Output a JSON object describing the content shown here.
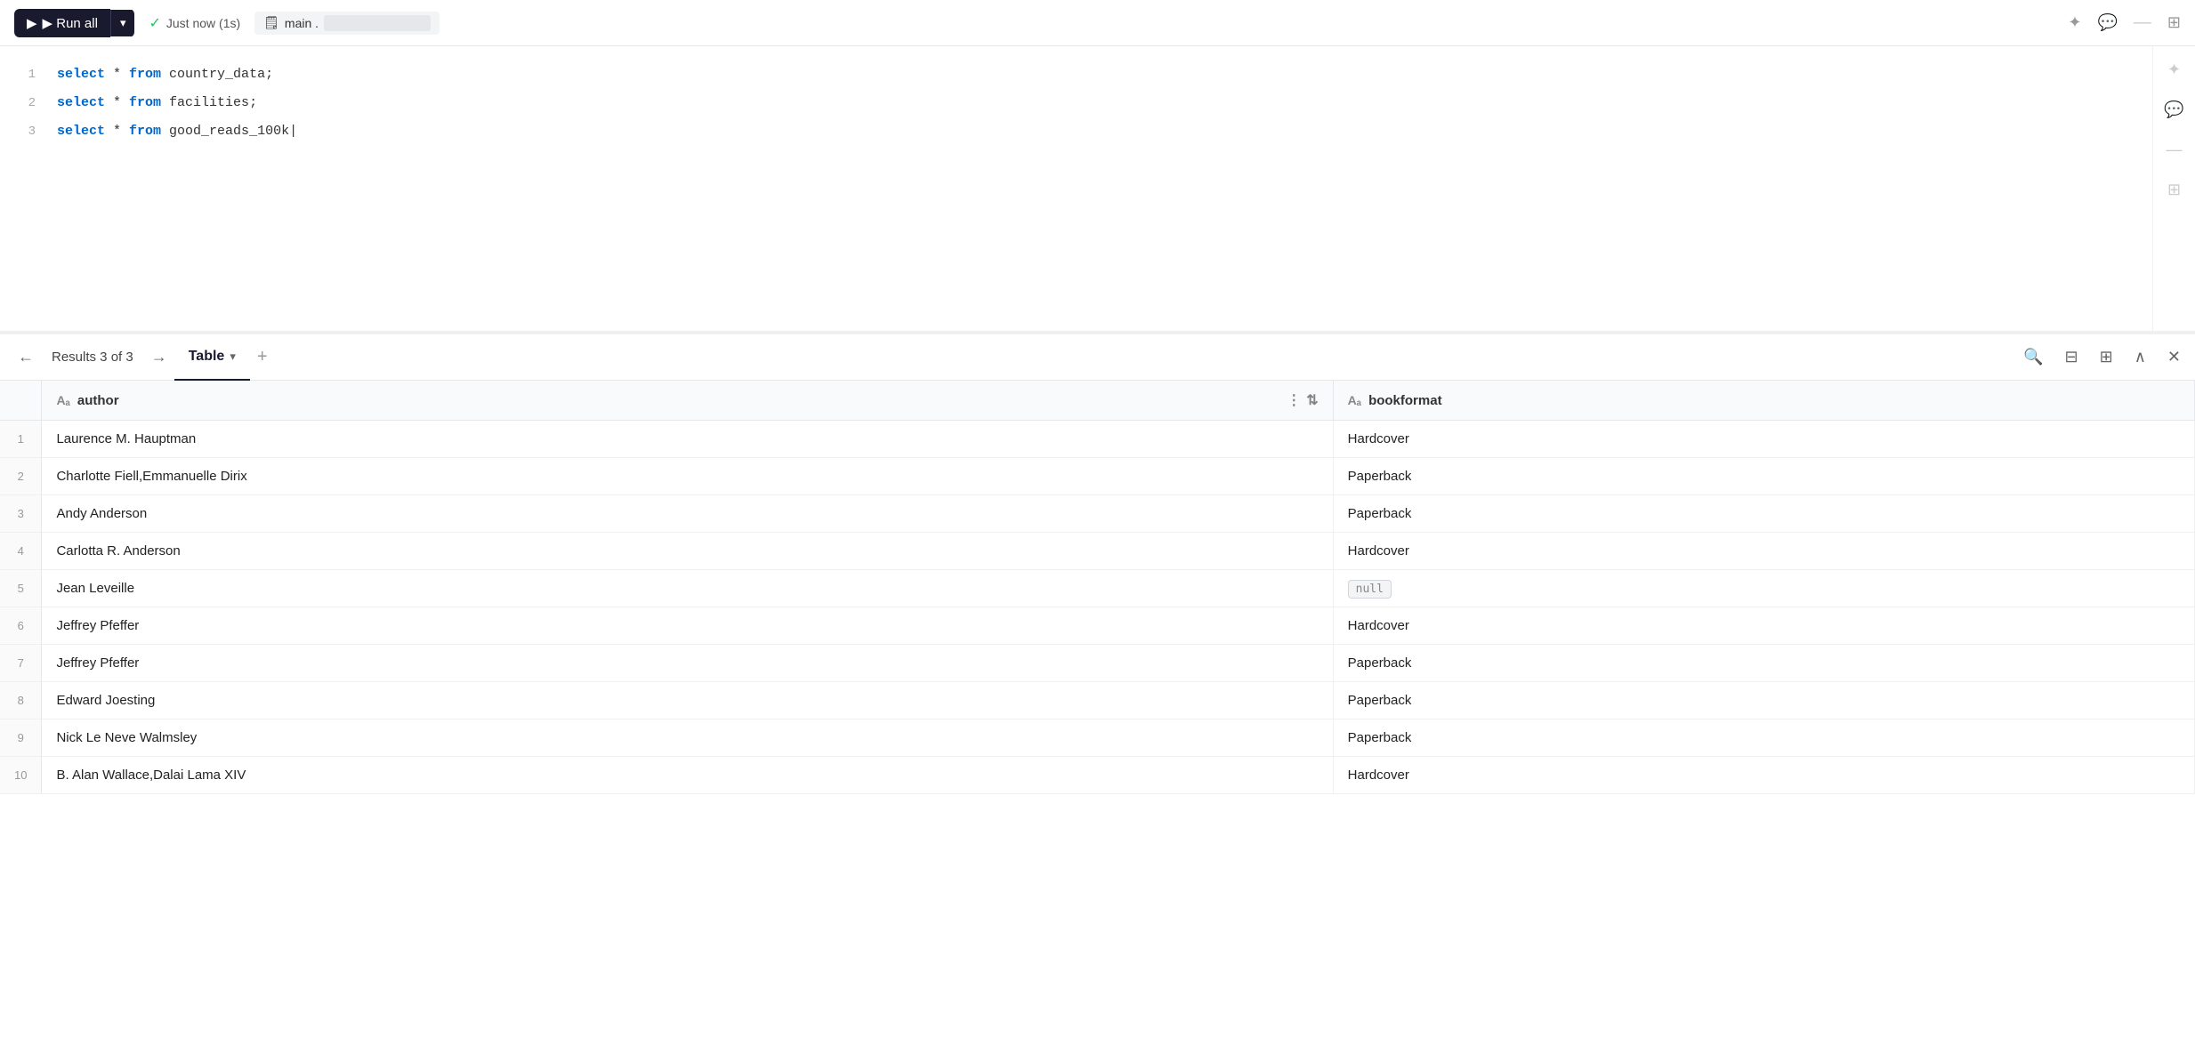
{
  "toolbar": {
    "run_all_label": "▶ Run all",
    "run_all_dropdown_arrow": "▾",
    "status_check": "✓",
    "status_text": "Just now (1s)",
    "db_icon": "🗒",
    "db_label": "main .",
    "db_name": "",
    "icon_sparkle": "✦",
    "icon_comment": "💬",
    "icon_divider": "—",
    "icon_grid": "⊞"
  },
  "editor": {
    "lines": [
      {
        "num": 1,
        "code": "select * from country_data;"
      },
      {
        "num": 2,
        "code": "select * from facilities;"
      },
      {
        "num": 3,
        "code": "select * from good_reads_100k"
      }
    ]
  },
  "results": {
    "nav_prev": "←",
    "nav_next": "→",
    "label": "Results 3 of 3",
    "tab_label": "Table",
    "tab_dropdown": "▾",
    "tab_add": "+",
    "icon_search": "🔍",
    "icon_filter": "⊟",
    "icon_layout": "⊞",
    "icon_chevron_up": "∧",
    "icon_close": "✕",
    "columns": [
      {
        "name": "author",
        "type": "Aₐ"
      },
      {
        "name": "bookformat",
        "type": "Aₐ"
      }
    ],
    "rows": [
      {
        "num": 1,
        "author": "Laurence M. Hauptman",
        "bookformat": "Hardcover",
        "null": false
      },
      {
        "num": 2,
        "author": "Charlotte Fiell,Emmanuelle Dirix",
        "bookformat": "Paperback",
        "null": false
      },
      {
        "num": 3,
        "author": "Andy Anderson",
        "bookformat": "Paperback",
        "null": false
      },
      {
        "num": 4,
        "author": "Carlotta R. Anderson",
        "bookformat": "Hardcover",
        "null": false
      },
      {
        "num": 5,
        "author": "Jean Leveille",
        "bookformat": null,
        "null": true
      },
      {
        "num": 6,
        "author": "Jeffrey Pfeffer",
        "bookformat": "Hardcover",
        "null": false
      },
      {
        "num": 7,
        "author": "Jeffrey Pfeffer",
        "bookformat": "Paperback",
        "null": false
      },
      {
        "num": 8,
        "author": "Edward Joesting",
        "bookformat": "Paperback",
        "null": false
      },
      {
        "num": 9,
        "author": "Nick Le Neve Walmsley",
        "bookformat": "Paperback",
        "null": false
      },
      {
        "num": 10,
        "author": "B. Alan Wallace,Dalai Lama XIV",
        "bookformat": "Hardcover",
        "null": false
      }
    ]
  }
}
